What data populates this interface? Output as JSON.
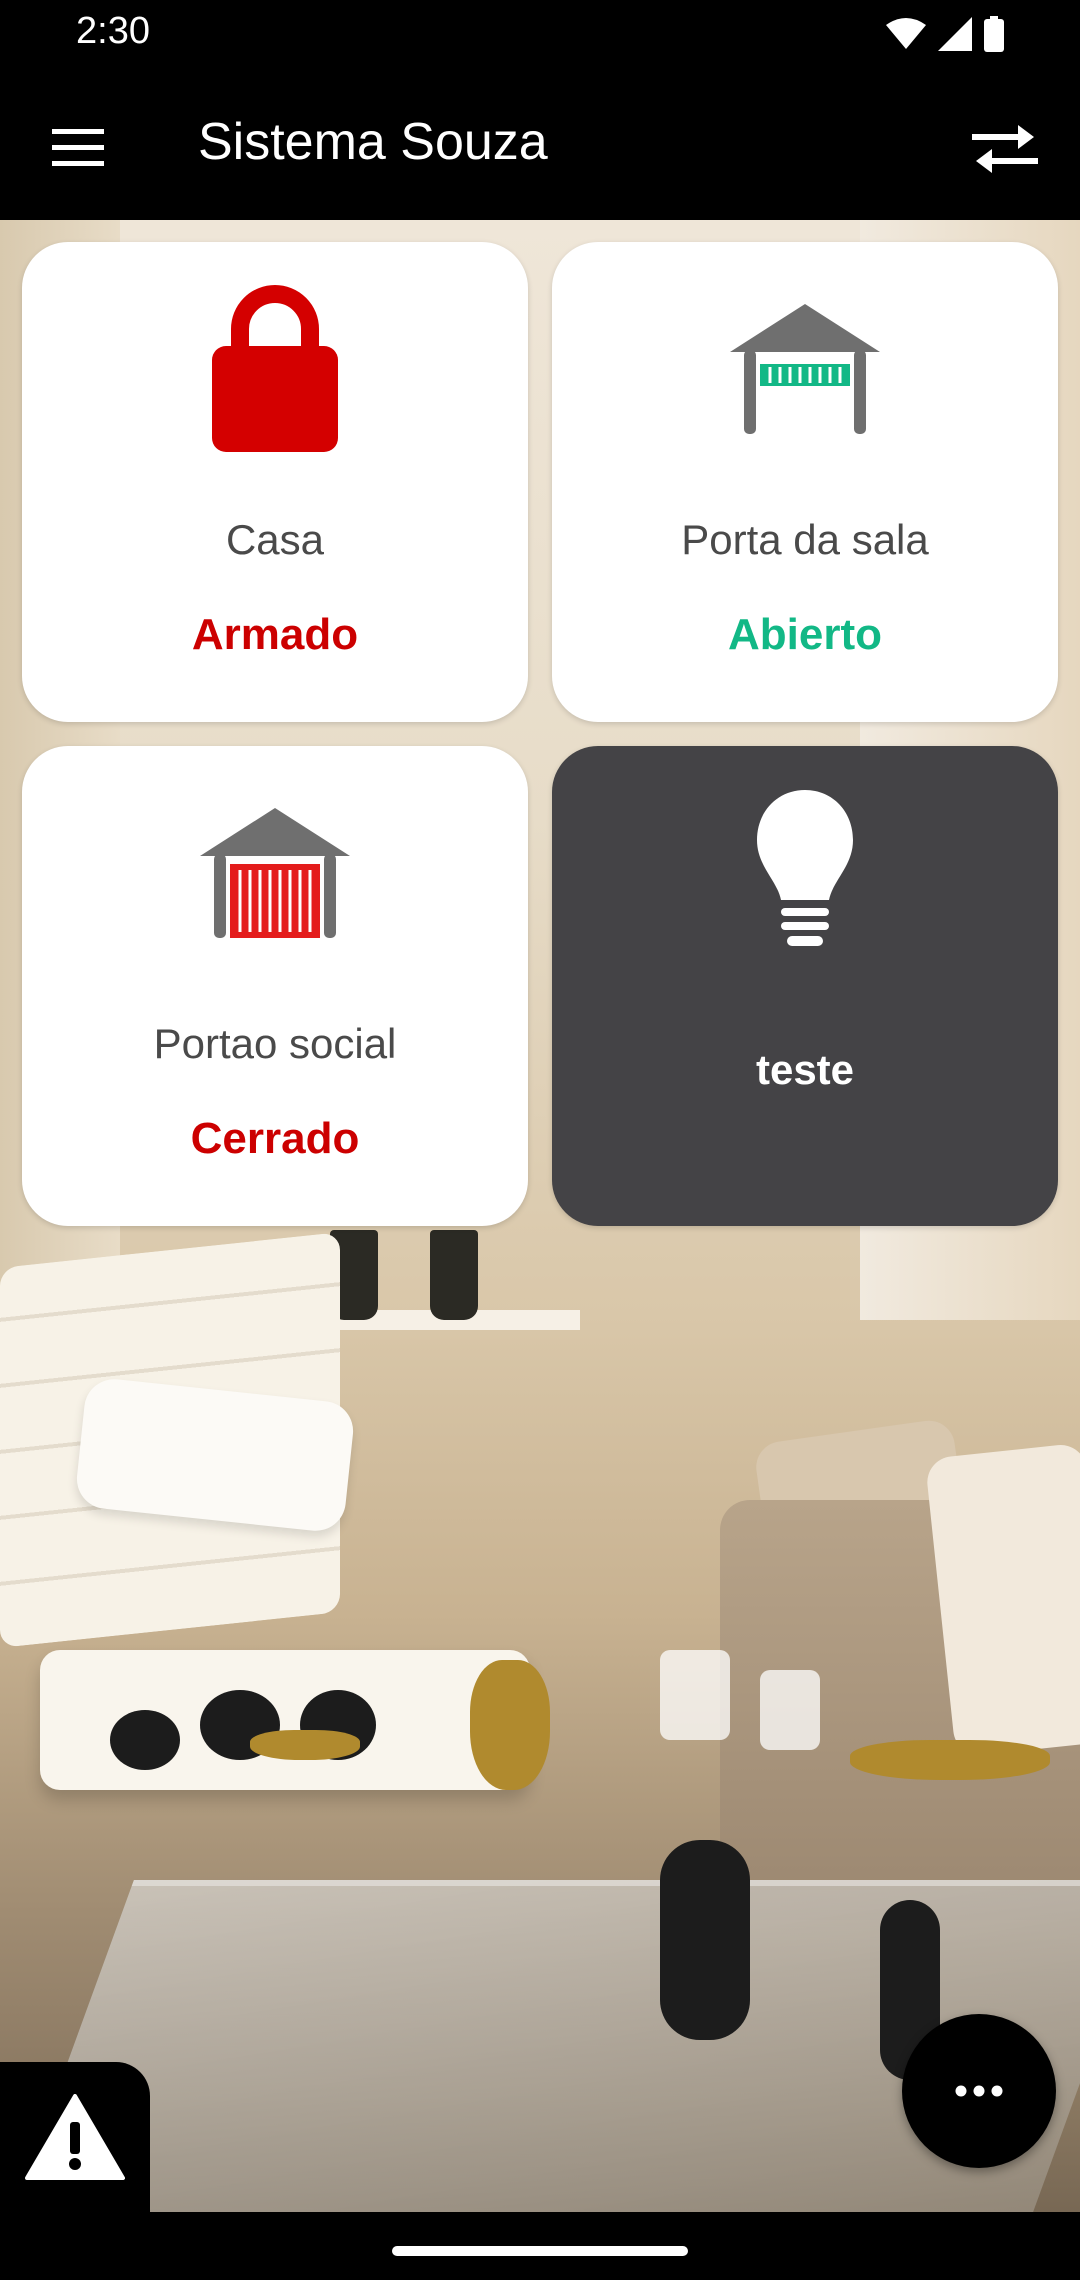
{
  "status_bar": {
    "time": "2:30",
    "icons": [
      "wifi-icon",
      "signal-icon",
      "battery-icon"
    ]
  },
  "app_bar": {
    "title": "Sistema Souza",
    "menu_icon": "menu-icon",
    "swap_icon": "swap-arrows-icon"
  },
  "cards": [
    {
      "name": "Casa",
      "status": "Armado",
      "status_color": "#cc0000",
      "icon": "padlock-icon"
    },
    {
      "name": "Porta da sala",
      "status": "Abierto",
      "status_color": "#12b886",
      "icon": "garage-open-icon"
    },
    {
      "name": "Portao social",
      "status": "Cerrado",
      "status_color": "#cc0000",
      "icon": "garage-closed-icon"
    },
    {
      "name": "teste",
      "status": "",
      "icon": "lightbulb-icon"
    }
  ],
  "colors": {
    "brand_bar": "#000000",
    "alarm_red": "#cc0000",
    "open_green": "#12b886",
    "dark_card": "#444346"
  },
  "bottom": {
    "alert_icon": "warning-icon",
    "fab_icon": "more-horizontal-icon"
  }
}
